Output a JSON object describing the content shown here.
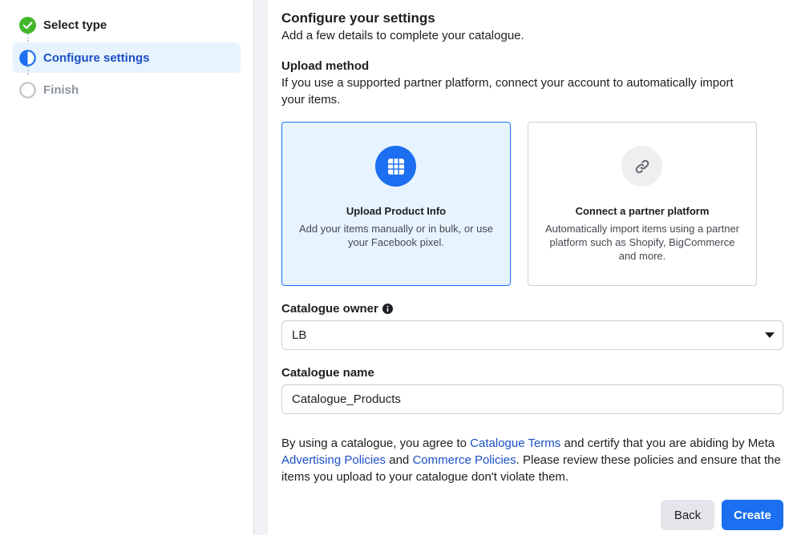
{
  "sidebar": {
    "steps": [
      {
        "label": "Select type",
        "state": "complete",
        "icon": "check-circle-icon"
      },
      {
        "label": "Configure settings",
        "state": "active",
        "icon": "half-circle-icon"
      },
      {
        "label": "Finish",
        "state": "pending",
        "icon": "empty-circle-icon"
      }
    ]
  },
  "main": {
    "heading": "Configure your settings",
    "subheading": "Add a few details to complete your catalogue.",
    "upload_method": {
      "title": "Upload method",
      "description": "If you use a supported partner platform, connect your account to automatically import your items.",
      "options": [
        {
          "title": "Upload Product Info",
          "description": "Add your items manually or in bulk, or use your Facebook pixel.",
          "icon": "grid-icon",
          "selected": true
        },
        {
          "title": "Connect a partner platform",
          "description": "Automatically import items using a partner platform such as Shopify, BigCommerce and more.",
          "icon": "link-icon",
          "selected": false
        }
      ]
    },
    "owner": {
      "label": "Catalogue owner",
      "value": "LB"
    },
    "name": {
      "label": "Catalogue name",
      "value": "Catalogue_Products"
    },
    "terms": {
      "t1": "By using a catalogue, you agree to ",
      "link1": "Catalogue Terms",
      "t2": " and certify that you are abiding by Meta ",
      "link2": "Advertising Policies",
      "t3": " and ",
      "link3": "Commerce Policies",
      "t4": ". Please review these policies and ensure that the items you upload to your catalogue don't violate them."
    },
    "buttons": {
      "back": "Back",
      "create": "Create"
    }
  },
  "colors": {
    "accent": "#1b6ff0",
    "complete": "#42b72a",
    "active_text": "#1b4fc4",
    "selected_bg": "#e7f3ff"
  }
}
